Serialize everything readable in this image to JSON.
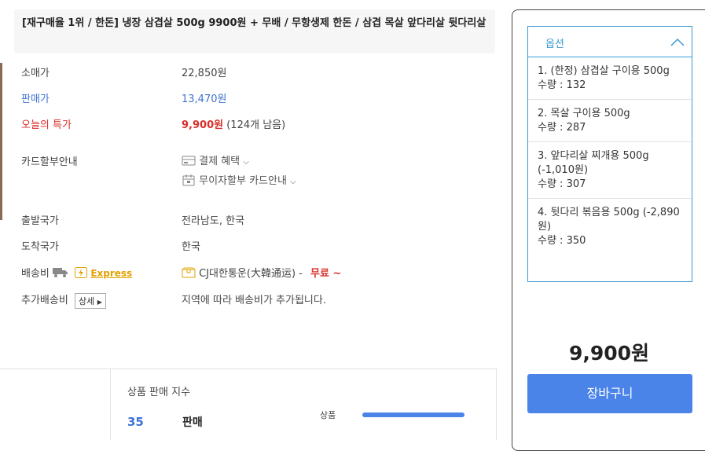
{
  "product": {
    "title": "[재구매율 1위 / 한돈] 냉장 삼겹살 500g 9900원 + 무배 / 무항생제 한돈 / 삼겹 목살 앞다리살 뒷다리살"
  },
  "pricing": {
    "retail_label": "소매가",
    "retail_value": "22,850원",
    "sale_label": "판매가",
    "sale_value": "13,470원",
    "special_label": "오늘의 특가",
    "special_value": "9,900원",
    "special_remaining": "(124개 남음)"
  },
  "card": {
    "label": "카드할부안내",
    "benefit_text": "결제 혜택",
    "installment_text": "무이자할부 카드안내"
  },
  "shipping": {
    "origin_label": "출발국가",
    "origin_value": "전라남도, 한국",
    "dest_label": "도착국가",
    "dest_value": "한국",
    "fee_label": "배송비",
    "express_label": "Express",
    "carrier": "CJ대한통운(大韓通运) -",
    "free_text": "무료 ~",
    "extra_label": "추가배송비",
    "detail_button": "상세",
    "extra_value": "지역에 따라 배송비가 추가됩니다."
  },
  "options": {
    "header": "옵션",
    "items": [
      {
        "name": "1. (한정) 삼겹살 구이용 500g",
        "qty": "수량 : 132"
      },
      {
        "name": "2. 목살 구이용 500g",
        "qty": "수량 : 287"
      },
      {
        "name": "3. 앞다리살 찌개용 500g (-1,010원)",
        "qty": "수량 : 307"
      },
      {
        "name": "4. 뒷다리 볶음용 500g (-2,890원)",
        "qty": "수량 : 350"
      }
    ]
  },
  "total_price": "9,900원",
  "cart_button": "장바구니",
  "sales_index": {
    "title": "상품 판매 지수",
    "count": "35",
    "sales_label": "판매",
    "product_label": "상품",
    "product_level": 1.0
  }
}
